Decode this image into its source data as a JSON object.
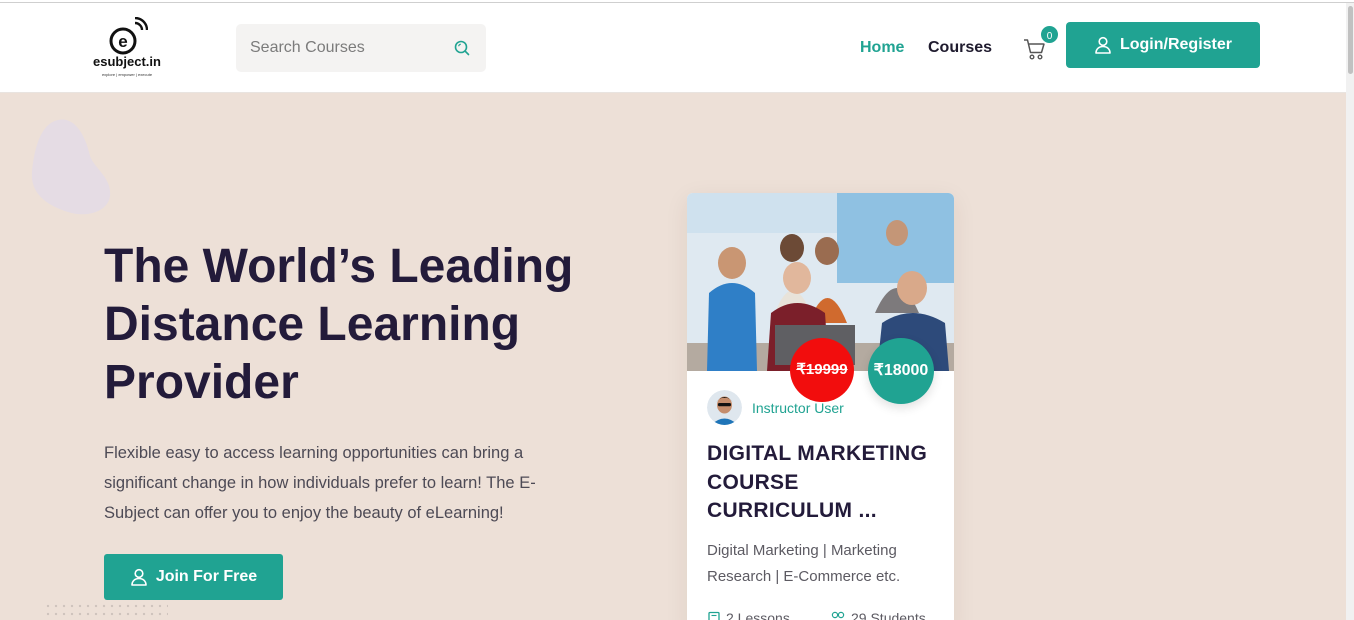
{
  "header": {
    "logo_text": "esubject.in",
    "logo_tagline": "explore | empower | execute",
    "search_placeholder": "Search Courses",
    "nav": {
      "home": "Home",
      "courses": "Courses"
    },
    "cart_count": "0",
    "login_label": "Login/Register"
  },
  "hero": {
    "title": "The World’s Leading Distance Learning Provider",
    "description": "Flexible easy to access learning opportunities can bring a significant change in how individuals prefer to learn! The E-Subject can offer you to enjoy the beauty of eLearning!",
    "join_label": "Join For Free"
  },
  "course_card": {
    "old_price": "₹19999",
    "new_price": "₹18000",
    "instructor": "Instructor User",
    "title": "DIGITAL MARKETING COURSE CURRICULUM ...",
    "description": "Digital Marketing | Marketing Research | E-Commerce etc.",
    "lessons": "2 Lessons",
    "students": "29 Students"
  },
  "colors": {
    "accent": "#20a392",
    "hero_bg": "#ede0d7",
    "heading": "#231b3a",
    "sale_red": "#f20d0d"
  },
  "icons": {
    "search": "search-icon",
    "cart": "cart-icon",
    "user": "user-icon",
    "book": "book-icon",
    "students": "students-icon"
  }
}
